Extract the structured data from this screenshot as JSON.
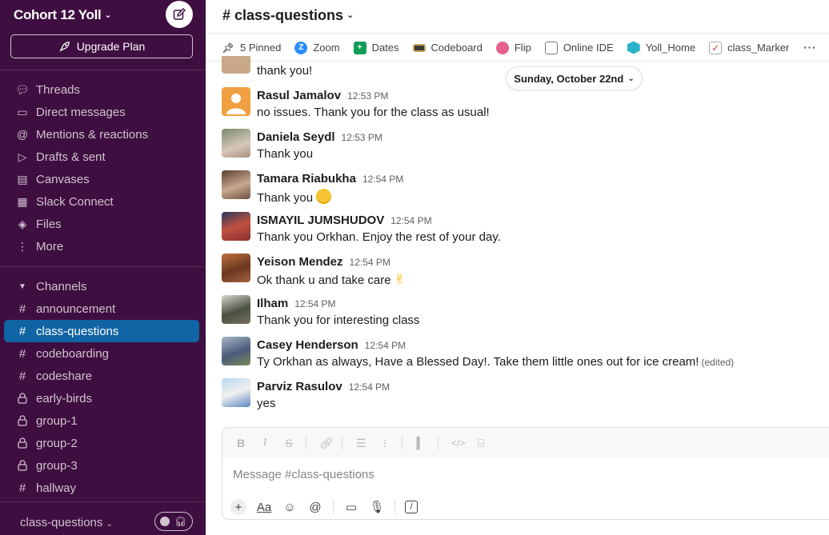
{
  "workspace": {
    "name": "Cohort 12 Yoll",
    "upgrade_label": "Upgrade Plan"
  },
  "nav": [
    {
      "label": "Threads",
      "icon": "threads-icon"
    },
    {
      "label": "Direct messages",
      "icon": "dm-icon"
    },
    {
      "label": "Mentions & reactions",
      "icon": "at-icon"
    },
    {
      "label": "Drafts & sent",
      "icon": "send-icon"
    },
    {
      "label": "Canvases",
      "icon": "canvas-icon"
    },
    {
      "label": "Slack Connect",
      "icon": "connect-icon"
    },
    {
      "label": "Files",
      "icon": "files-icon"
    },
    {
      "label": "More",
      "icon": "more-icon"
    }
  ],
  "channels_header": "Channels",
  "channels": [
    {
      "label": "announcement",
      "private": false
    },
    {
      "label": "class-questions",
      "private": false,
      "active": true
    },
    {
      "label": "codeboarding",
      "private": false
    },
    {
      "label": "codeshare",
      "private": false
    },
    {
      "label": "early-birds",
      "private": true
    },
    {
      "label": "group-1",
      "private": true
    },
    {
      "label": "group-2",
      "private": true
    },
    {
      "label": "group-3",
      "private": true
    },
    {
      "label": "hallway",
      "private": false
    }
  ],
  "footer": {
    "channel": "class-questions"
  },
  "channel_header": {
    "title": "# class-questions"
  },
  "bookmarks": [
    {
      "label": "5 Pinned",
      "icon": "pin-icon",
      "color": "#616061"
    },
    {
      "label": "Zoom",
      "icon": "zoom-icon",
      "color": "#2d8cff"
    },
    {
      "label": "Dates",
      "icon": "sheets-icon",
      "color": "#0f9d58"
    },
    {
      "label": "Codeboard",
      "icon": "codeboard-icon",
      "color": "#3b3b3b"
    },
    {
      "label": "Flip",
      "icon": "flip-icon",
      "color": "#e8608a"
    },
    {
      "label": "Online IDE",
      "icon": "ide-icon",
      "color": "#7a7a7a"
    },
    {
      "label": "Yoll_Home",
      "icon": "yoll-icon",
      "color": "#2ab3c9"
    },
    {
      "label": "class_Marker",
      "icon": "marker-icon",
      "color": "#e03a3a"
    }
  ],
  "date_divider": "Sunday, October 22nd",
  "partial_message": {
    "text": "thank you!"
  },
  "messages": [
    {
      "name": "Rasul Jamalov",
      "time": "12:53 PM",
      "text": "no issues. Thank you for the class as usual!",
      "avatar_color": "#f0a040"
    },
    {
      "name": "Daniela Seydl",
      "time": "12:53 PM",
      "text": "Thank you",
      "avatar_color": "#c9b8a8"
    },
    {
      "name": "Tamara Riabukha",
      "time": "12:54 PM",
      "text": "Thank you",
      "avatar_color": "#8a6a55",
      "emoji": "smile-emoji"
    },
    {
      "name": "ISMAYIL JUMSHUDOV",
      "time": "12:54 PM",
      "text": "Thank you Orkhan. Enjoy the rest of your day.",
      "avatar_color": "#b23a3a"
    },
    {
      "name": "Yeison Mendez",
      "time": "12:54 PM",
      "text": "Ok thank u and take care",
      "avatar_color": "#9b5530",
      "emoji": "victory-emoji"
    },
    {
      "name": "Ilham",
      "time": "12:54 PM",
      "text": "Thank you for interesting class",
      "avatar_color": "#5a6a50"
    },
    {
      "name": "Casey Henderson",
      "time": "12:54 PM",
      "text": "Ty Orkhan as always, Have a Blessed Day!. Take them little ones out for ice cream!",
      "edited": "(edited)",
      "avatar_color": "#5a6a8a"
    },
    {
      "name": "Parviz Rasulov",
      "time": "12:54 PM",
      "text": "yes",
      "avatar_color": "#7aa0c8"
    }
  ],
  "composer": {
    "placeholder": "Message #class-questions"
  }
}
